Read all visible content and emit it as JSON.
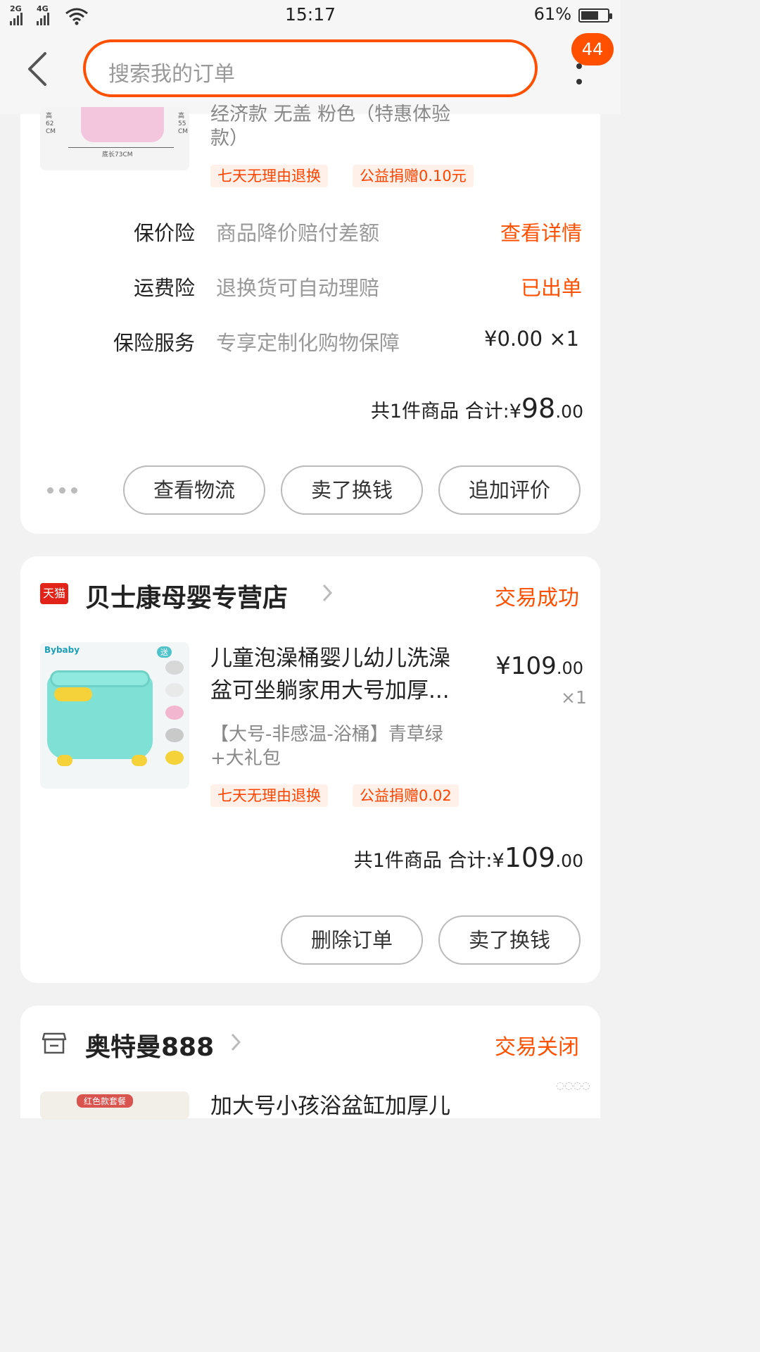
{
  "status_bar": {
    "net1": "2G",
    "net2": "4G",
    "time": "15:17",
    "battery": "61%"
  },
  "header": {
    "search_placeholder": "搜索我的订单",
    "badge_count": "44"
  },
  "order1": {
    "title_partial_line1": "经济款 无盖 粉色（特惠体验",
    "title_partial_line2": "款）",
    "img_label_height_left": "高",
    "img_label_height_left2": "62",
    "img_label_height_left3": "CM",
    "img_label_height_right": "高",
    "img_label_height_right2": "55",
    "img_label_height_right3": "CM",
    "img_label_bottom": "底长73CM",
    "tags": [
      "七天无理由退换",
      "公益捐赠0.10元"
    ],
    "insurance": [
      {
        "label": "保价险",
        "desc": "商品降价赔付差额",
        "right": "查看详情"
      },
      {
        "label": "运费险",
        "desc": "退换货可自动理赔",
        "right": "已出单"
      },
      {
        "label": "保险服务",
        "desc": "专享定制化购物保障",
        "right": "¥0.00 ×1"
      }
    ],
    "total_prefix": "共1件商品  合计:",
    "total_currency": "¥",
    "total_int": "98",
    "total_dec": ".00",
    "buttons": [
      "查看物流",
      "卖了换钱",
      "追加评价"
    ]
  },
  "order2": {
    "platform_badge": "天猫",
    "shop": "贝士康母婴专营店",
    "status": "交易成功",
    "title_line1": "儿童泡澡桶婴儿幼儿洗澡",
    "title_line2": "盆可坐躺家用大号加厚...",
    "spec_line1": "【大号-非感温-浴桶】青草绿",
    "spec_line2": "+大礼包",
    "price_currency": "¥",
    "price_int": "109",
    "price_dec": ".00",
    "qty": "×1",
    "img_brand": "Bybaby",
    "img_badge": "送",
    "tags": [
      "七天无理由退换",
      "公益捐赠0.02"
    ],
    "total_prefix": "共1件商品  合计:",
    "total_currency": "¥",
    "total_int": "109",
    "total_dec": ".00",
    "buttons": [
      "删除订单",
      "卖了换钱"
    ]
  },
  "order3": {
    "shop": "奥特曼888",
    "status": "交易关闭",
    "title_partial": "加大号小孩浴盆缸加厚儿",
    "img_label": "红色款套餐"
  },
  "colors": {
    "accent": "#ff5000",
    "tag_bg": "#fff1ea"
  },
  "icons": [
    "back-chevron-icon",
    "more-vertical-icon",
    "tmall-icon",
    "store-icon",
    "chevron-right-icon"
  ]
}
